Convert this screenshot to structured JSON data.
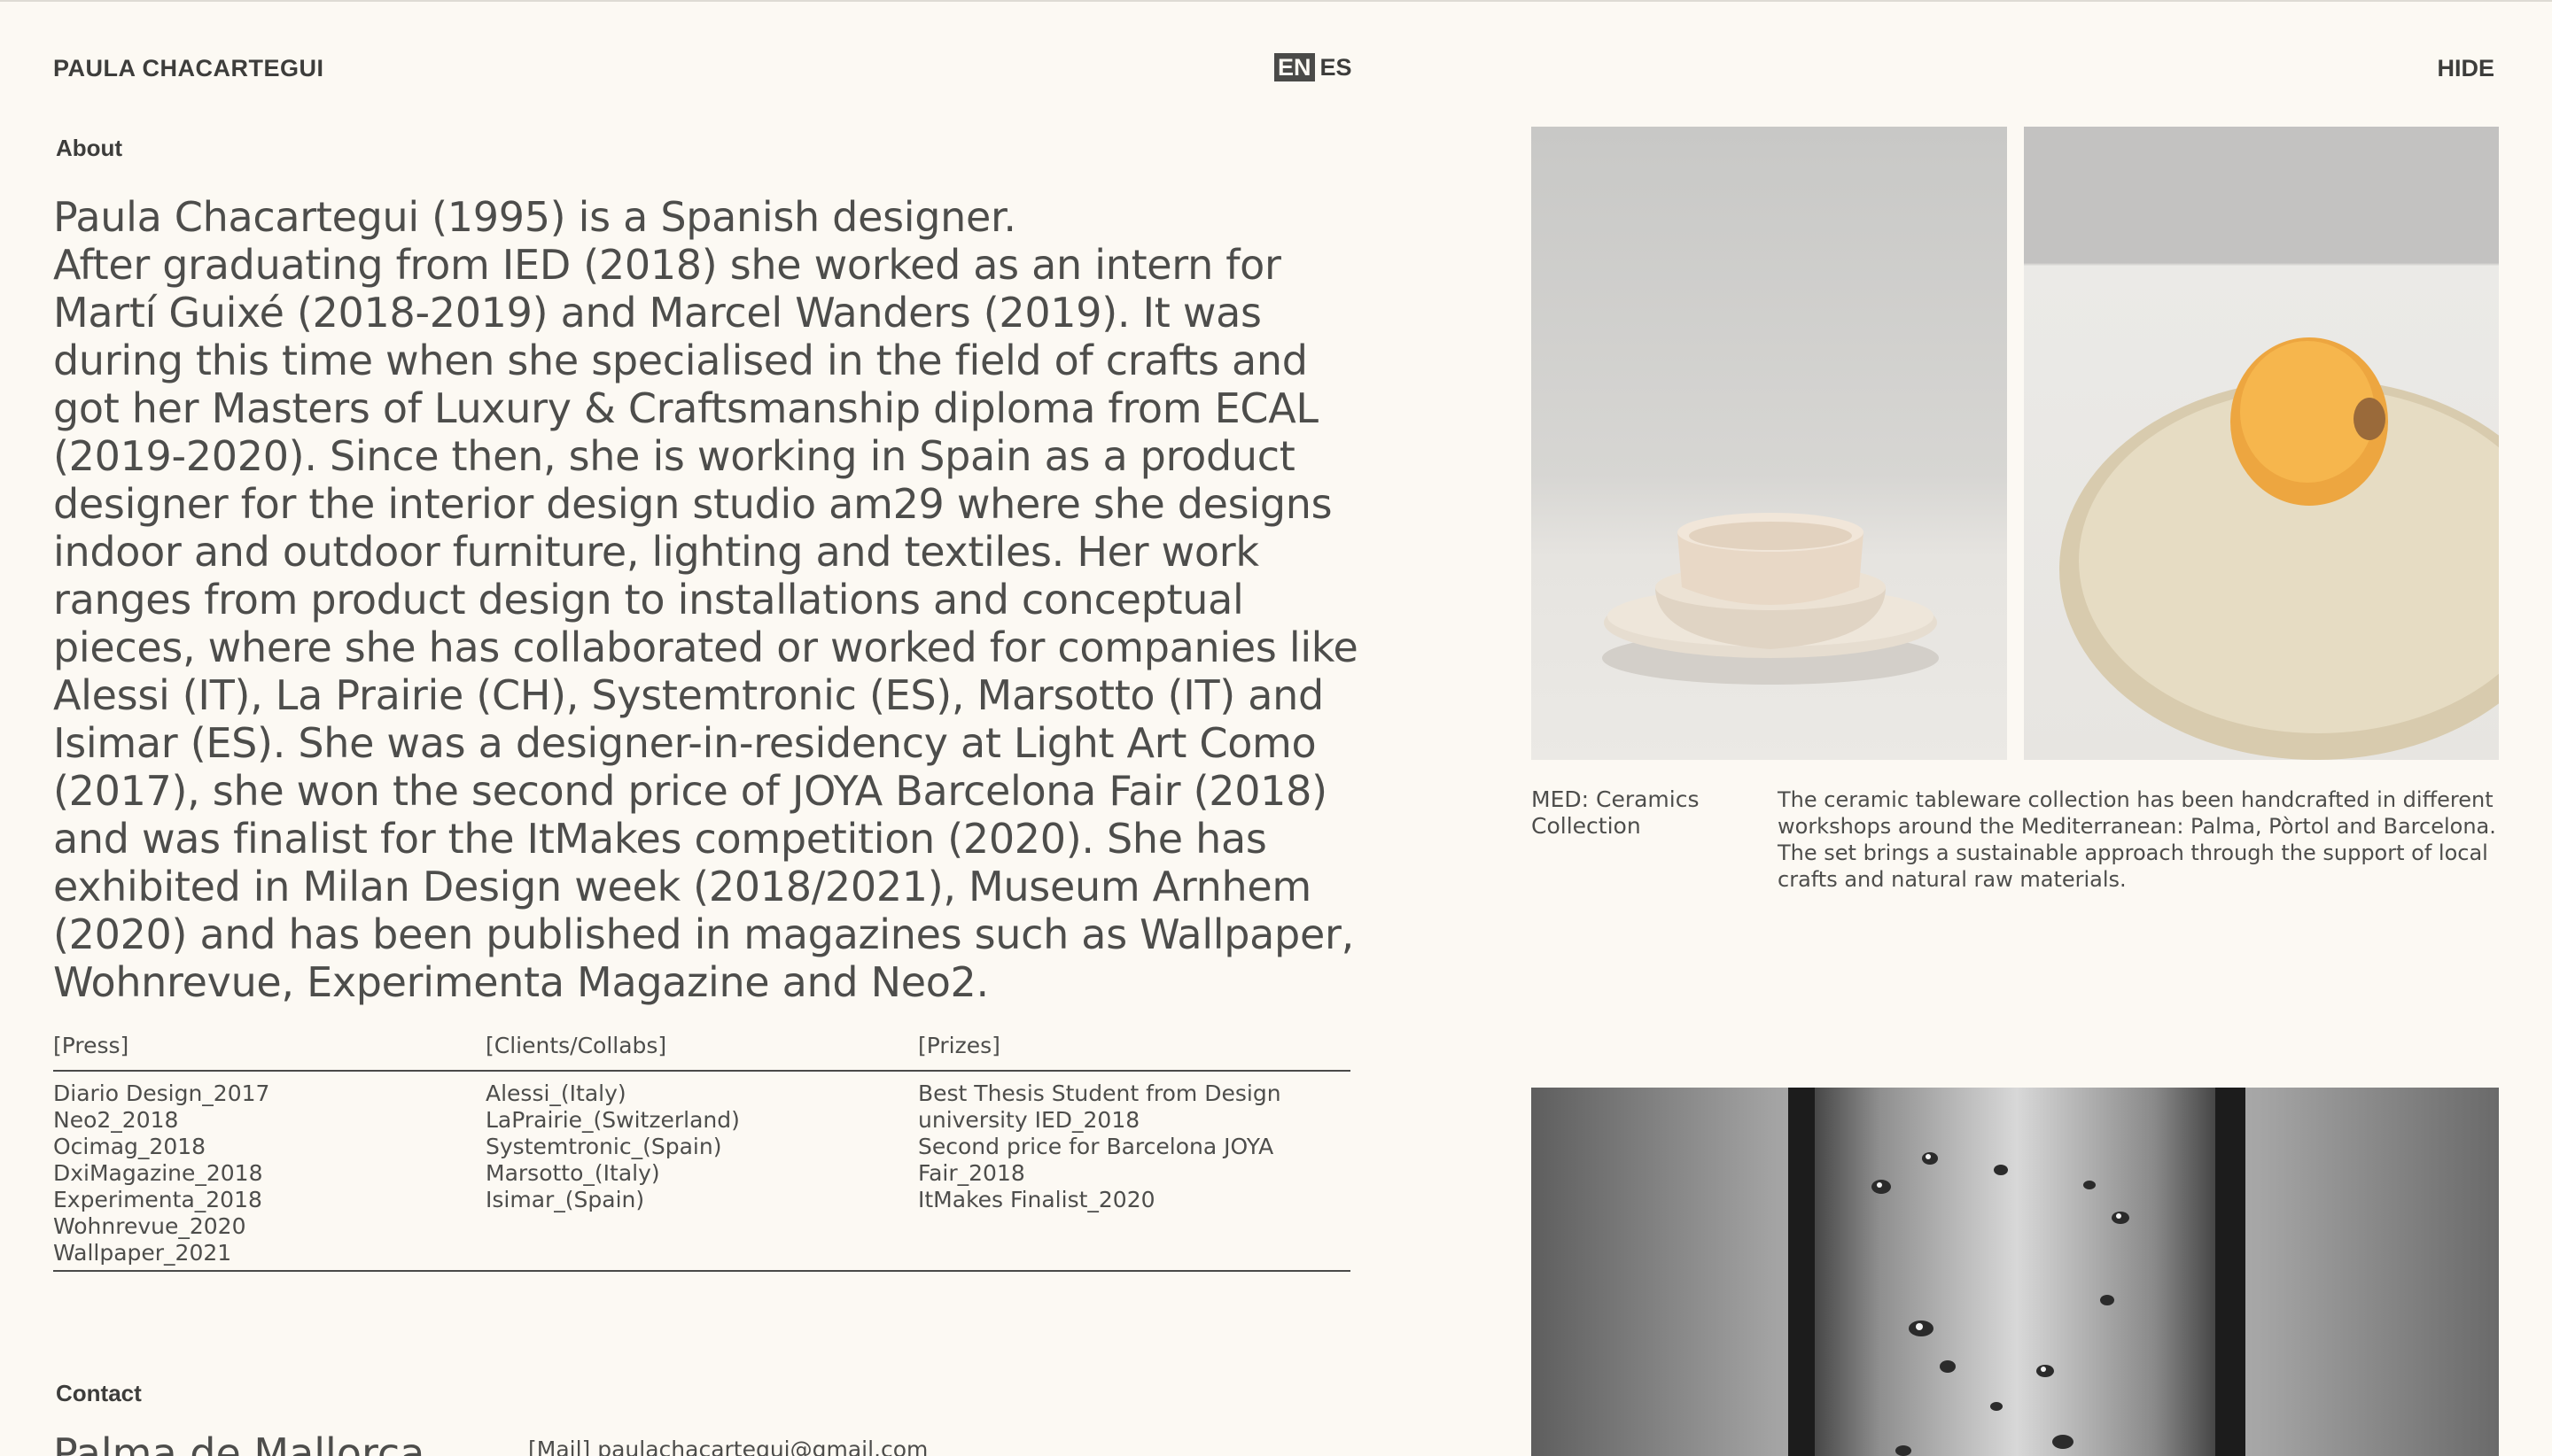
{
  "header": {
    "brand": "PAULA CHACARTEGUI",
    "lang_active": "EN",
    "lang_inactive": "ES",
    "hide_label": "HIDE"
  },
  "about": {
    "label": "About",
    "text": "Paula Chacartegui (1995) is a Spanish designer.\nAfter graduating from IED (2018) she worked as an intern for Martí Guixé (2018-2019) and Marcel Wanders (2019). It was during this time when she specialised in the field of crafts and got her Masters of Luxury & Craftsmanship diploma from ECAL (2019-2020). Since then, she is working in Spain as a product designer for the interior design studio am29 where she designs indoor and outdoor furniture, lighting and textiles. Her work ranges from product design to installations and conceptual pieces, where she has collaborated or worked for companies like Alessi (IT), La Prairie (CH), Systemtronic (ES), Marsotto (IT) and Isimar (ES). She was a designer-in-residency at Light Art Como (2017), she won the second price of JOYA Barcelona Fair (2018) and was finalist for the ItMakes competition (2020). She has exhibited in Milan Design week (2018/2021), Museum Arnhem (2020) and has been published in magazines such as Wallpaper, Wohnrevue, Experimenta Magazine and Neo2."
  },
  "lists": {
    "press_header": "[Press]",
    "clients_header": "[Clients/Collabs]",
    "prizes_header": "[Prizes]",
    "press": [
      "Diario Design_2017",
      "Neo2_2018",
      "Ocimag_2018",
      "DxiMagazine_2018",
      "Experimenta_2018",
      "Wohnrevue_2020",
      "Wallpaper_2021"
    ],
    "clients": [
      "Alessi_(Italy)",
      "LaPrairie_(Switzerland)",
      "Systemtronic_(Spain)",
      "Marsotto_(Italy)",
      "Isimar_(Spain)"
    ],
    "prizes": [
      "Best Thesis Student from Design university IED_2018",
      "Second price for Barcelona JOYA Fair_2018",
      "ItMakes Finalist_2020"
    ]
  },
  "contact": {
    "label": "Contact",
    "city": "Palma de Mallorca",
    "mail": "[Mail] paulachacartegui@gmail.com"
  },
  "project": {
    "title": "MED: Ceramics Collection",
    "description": "The ceramic tableware collection has been handcrafted in different workshops around the Mediterranean: Palma, Pòrtol and Barcelona. The set brings a sustainable approach through the support of local crafts and natural raw materials."
  }
}
